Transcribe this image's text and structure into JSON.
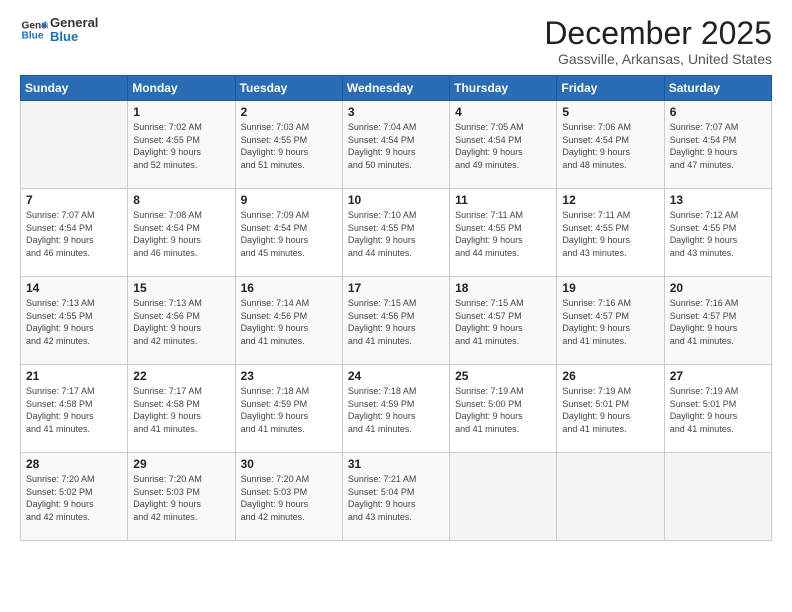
{
  "logo": {
    "line1": "General",
    "line2": "Blue"
  },
  "title": "December 2025",
  "subtitle": "Gassville, Arkansas, United States",
  "header": {
    "days": [
      "Sunday",
      "Monday",
      "Tuesday",
      "Wednesday",
      "Thursday",
      "Friday",
      "Saturday"
    ]
  },
  "weeks": [
    [
      {
        "day": "",
        "info": ""
      },
      {
        "day": "1",
        "info": "Sunrise: 7:02 AM\nSunset: 4:55 PM\nDaylight: 9 hours\nand 52 minutes."
      },
      {
        "day": "2",
        "info": "Sunrise: 7:03 AM\nSunset: 4:55 PM\nDaylight: 9 hours\nand 51 minutes."
      },
      {
        "day": "3",
        "info": "Sunrise: 7:04 AM\nSunset: 4:54 PM\nDaylight: 9 hours\nand 50 minutes."
      },
      {
        "day": "4",
        "info": "Sunrise: 7:05 AM\nSunset: 4:54 PM\nDaylight: 9 hours\nand 49 minutes."
      },
      {
        "day": "5",
        "info": "Sunrise: 7:06 AM\nSunset: 4:54 PM\nDaylight: 9 hours\nand 48 minutes."
      },
      {
        "day": "6",
        "info": "Sunrise: 7:07 AM\nSunset: 4:54 PM\nDaylight: 9 hours\nand 47 minutes."
      }
    ],
    [
      {
        "day": "7",
        "info": "Sunrise: 7:07 AM\nSunset: 4:54 PM\nDaylight: 9 hours\nand 46 minutes."
      },
      {
        "day": "8",
        "info": "Sunrise: 7:08 AM\nSunset: 4:54 PM\nDaylight: 9 hours\nand 46 minutes."
      },
      {
        "day": "9",
        "info": "Sunrise: 7:09 AM\nSunset: 4:54 PM\nDaylight: 9 hours\nand 45 minutes."
      },
      {
        "day": "10",
        "info": "Sunrise: 7:10 AM\nSunset: 4:55 PM\nDaylight: 9 hours\nand 44 minutes."
      },
      {
        "day": "11",
        "info": "Sunrise: 7:11 AM\nSunset: 4:55 PM\nDaylight: 9 hours\nand 44 minutes."
      },
      {
        "day": "12",
        "info": "Sunrise: 7:11 AM\nSunset: 4:55 PM\nDaylight: 9 hours\nand 43 minutes."
      },
      {
        "day": "13",
        "info": "Sunrise: 7:12 AM\nSunset: 4:55 PM\nDaylight: 9 hours\nand 43 minutes."
      }
    ],
    [
      {
        "day": "14",
        "info": "Sunrise: 7:13 AM\nSunset: 4:55 PM\nDaylight: 9 hours\nand 42 minutes."
      },
      {
        "day": "15",
        "info": "Sunrise: 7:13 AM\nSunset: 4:56 PM\nDaylight: 9 hours\nand 42 minutes."
      },
      {
        "day": "16",
        "info": "Sunrise: 7:14 AM\nSunset: 4:56 PM\nDaylight: 9 hours\nand 41 minutes."
      },
      {
        "day": "17",
        "info": "Sunrise: 7:15 AM\nSunset: 4:56 PM\nDaylight: 9 hours\nand 41 minutes."
      },
      {
        "day": "18",
        "info": "Sunrise: 7:15 AM\nSunset: 4:57 PM\nDaylight: 9 hours\nand 41 minutes."
      },
      {
        "day": "19",
        "info": "Sunrise: 7:16 AM\nSunset: 4:57 PM\nDaylight: 9 hours\nand 41 minutes."
      },
      {
        "day": "20",
        "info": "Sunrise: 7:16 AM\nSunset: 4:57 PM\nDaylight: 9 hours\nand 41 minutes."
      }
    ],
    [
      {
        "day": "21",
        "info": "Sunrise: 7:17 AM\nSunset: 4:58 PM\nDaylight: 9 hours\nand 41 minutes."
      },
      {
        "day": "22",
        "info": "Sunrise: 7:17 AM\nSunset: 4:58 PM\nDaylight: 9 hours\nand 41 minutes."
      },
      {
        "day": "23",
        "info": "Sunrise: 7:18 AM\nSunset: 4:59 PM\nDaylight: 9 hours\nand 41 minutes."
      },
      {
        "day": "24",
        "info": "Sunrise: 7:18 AM\nSunset: 4:59 PM\nDaylight: 9 hours\nand 41 minutes."
      },
      {
        "day": "25",
        "info": "Sunrise: 7:19 AM\nSunset: 5:00 PM\nDaylight: 9 hours\nand 41 minutes."
      },
      {
        "day": "26",
        "info": "Sunrise: 7:19 AM\nSunset: 5:01 PM\nDaylight: 9 hours\nand 41 minutes."
      },
      {
        "day": "27",
        "info": "Sunrise: 7:19 AM\nSunset: 5:01 PM\nDaylight: 9 hours\nand 41 minutes."
      }
    ],
    [
      {
        "day": "28",
        "info": "Sunrise: 7:20 AM\nSunset: 5:02 PM\nDaylight: 9 hours\nand 42 minutes."
      },
      {
        "day": "29",
        "info": "Sunrise: 7:20 AM\nSunset: 5:03 PM\nDaylight: 9 hours\nand 42 minutes."
      },
      {
        "day": "30",
        "info": "Sunrise: 7:20 AM\nSunset: 5:03 PM\nDaylight: 9 hours\nand 42 minutes."
      },
      {
        "day": "31",
        "info": "Sunrise: 7:21 AM\nSunset: 5:04 PM\nDaylight: 9 hours\nand 43 minutes."
      },
      {
        "day": "",
        "info": ""
      },
      {
        "day": "",
        "info": ""
      },
      {
        "day": "",
        "info": ""
      }
    ]
  ]
}
